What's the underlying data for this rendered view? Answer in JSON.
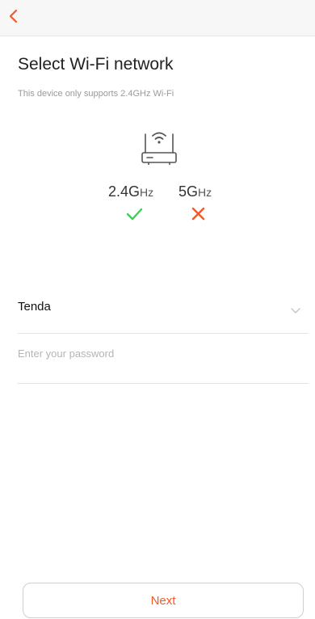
{
  "header": {
    "back_icon": "chevron-left-icon",
    "accent_color": "#ef5b2b"
  },
  "page": {
    "title": "Select Wi-Fi network",
    "subtitle": "This device only supports 2.4GHz Wi-Fi"
  },
  "bands": {
    "icon": "router-icon",
    "band_24": {
      "value": "2.4G",
      "unit": "Hz",
      "supported": true,
      "icon": "check-icon",
      "color": "#3ecf5a"
    },
    "band_5": {
      "value": "5G",
      "unit": "Hz",
      "supported": false,
      "icon": "cross-icon",
      "color": "#ef5b2b"
    }
  },
  "form": {
    "ssid_value": "Tenda",
    "ssid_dropdown_icon": "chevron-down-icon",
    "password_placeholder": "Enter your password",
    "password_value": ""
  },
  "footer": {
    "next_label": "Next"
  }
}
